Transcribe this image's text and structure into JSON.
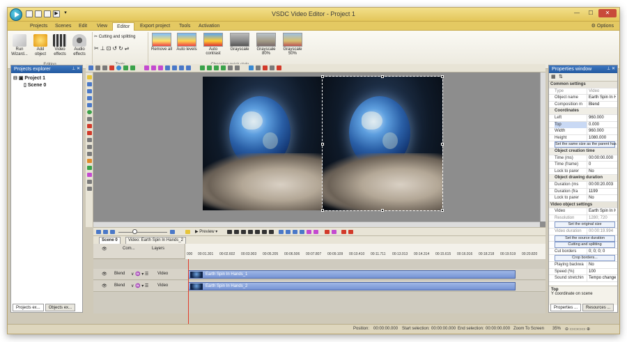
{
  "window": {
    "title": "VSDC Video Editor - Project 1"
  },
  "menu": {
    "items": [
      "Projects",
      "Scenes",
      "Edit",
      "View",
      "Editor",
      "Export project",
      "Tools",
      "Activation"
    ],
    "options": "Options"
  },
  "ribbon": {
    "run_wizard": "Run Wizard...",
    "add_object": "Add object",
    "video_effects": "Video effects",
    "audio_effects": "Audio effects",
    "editing_group": "Editing",
    "cutting_splitting": "Cutting and splitting",
    "tools_group": "Tools",
    "quick_styles": [
      "Remove all",
      "Auto levels",
      "Auto contrast",
      "Grayscale",
      "Grayscale 80%",
      "Grayscale 50%"
    ],
    "quick_style_group": "Choosing quick style"
  },
  "projects_explorer": {
    "title": "Projects explorer",
    "project": "Project 1",
    "scene": "Scene 0",
    "tabs": [
      "Projects ex...",
      "Objects ex..."
    ]
  },
  "timeline": {
    "preview": "Preview",
    "tabs": [
      "Scene 0",
      "Video: Earth Spin In Hands_2"
    ],
    "headers": {
      "com": "Com...",
      "layers": "Layers"
    },
    "ruler_ticks": [
      "000",
      "00:01.301",
      "00:02.602",
      "00:03.903",
      "00:05.205",
      "00:06.506",
      "00:07.807",
      "00:09.109",
      "00:10.410",
      "00:11.711",
      "00:13.013",
      "00:14.314",
      "00:15.615",
      "00:16.916",
      "00:18.218",
      "00:19.519",
      "00:20.820"
    ],
    "rows": [
      {
        "blend": "Blend",
        "type": "Video",
        "clip": "Earth Spin In Hands_1"
      },
      {
        "blend": "Blend",
        "type": "Video",
        "clip": "Earth Spin In Hands_2"
      }
    ]
  },
  "properties": {
    "title": "Properties window",
    "rows": [
      {
        "kind": "sec",
        "label": "Common settings"
      },
      {
        "kind": "row",
        "label": "Type",
        "value": "Video",
        "gray": true
      },
      {
        "kind": "row",
        "label": "Object name",
        "value": "Earth Spin In H"
      },
      {
        "kind": "row",
        "label": "Composition m",
        "value": "Blend"
      },
      {
        "kind": "sub",
        "label": "Coordinates"
      },
      {
        "kind": "row",
        "label": "Left",
        "value": "960.000"
      },
      {
        "kind": "row",
        "label": "Top",
        "value": "0.000",
        "hl": true
      },
      {
        "kind": "row",
        "label": "Width",
        "value": "960.000"
      },
      {
        "kind": "row",
        "label": "Height",
        "value": "1080.000"
      },
      {
        "kind": "btn",
        "label": "Set the same size as the parent has"
      },
      {
        "kind": "sub",
        "label": "Object creation time"
      },
      {
        "kind": "row",
        "label": "Time (ms)",
        "value": "00:00:00.000"
      },
      {
        "kind": "row",
        "label": "Time (frame)",
        "value": "0"
      },
      {
        "kind": "row",
        "label": "Lock to parer",
        "value": "No"
      },
      {
        "kind": "sub",
        "label": "Object drawing duration"
      },
      {
        "kind": "row",
        "label": "Duration (ms",
        "value": "00:00:20.003"
      },
      {
        "kind": "row",
        "label": "Duration (fra",
        "value": "1199"
      },
      {
        "kind": "row",
        "label": "Lock to parer",
        "value": "No"
      },
      {
        "kind": "sec",
        "label": "Video object settings"
      },
      {
        "kind": "row",
        "label": "Video",
        "value": "Earth Spin In H"
      },
      {
        "kind": "row",
        "label": "Resolution",
        "value": "1280; 720",
        "gray": true
      },
      {
        "kind": "btn",
        "label": "Set the original size"
      },
      {
        "kind": "row",
        "label": "Video duration",
        "value": "00:00:19.994",
        "gray": true
      },
      {
        "kind": "btn",
        "label": "Set the source duration"
      },
      {
        "kind": "btn",
        "label": "Cutting and splitting"
      },
      {
        "kind": "row",
        "label": "Cut borders",
        "value": "0; 0; 0; 0"
      },
      {
        "kind": "btn",
        "label": "Crop borders..."
      },
      {
        "kind": "row",
        "label": "Playing backwa",
        "value": "No"
      },
      {
        "kind": "row",
        "label": "Speed (%)",
        "value": "100"
      },
      {
        "kind": "row",
        "label": "Sound stretchin",
        "value": "Tempo change"
      }
    ],
    "desc_title": "Top",
    "desc_text": "Y coordinate on scene",
    "tabs": [
      "Properties ...",
      "Resources ..."
    ]
  },
  "status": {
    "position_label": "Position:",
    "position_value": "00:00:00.000",
    "start_sel_label": "Start selection:",
    "start_sel_value": "00:00:00.000",
    "end_sel_label": "End selection:",
    "end_sel_value": "00:00:00.000",
    "zoom_label": "Zoom To Screen",
    "zoom_value": "35%"
  }
}
